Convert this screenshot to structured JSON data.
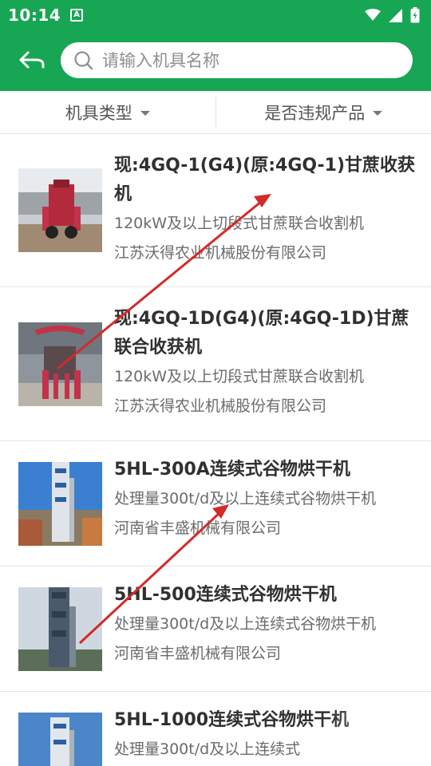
{
  "status_bar": {
    "time": "10:14",
    "notification_letter": "A"
  },
  "header": {
    "search_placeholder": "请输入机具名称"
  },
  "filters": [
    {
      "label": "机具类型"
    },
    {
      "label": "是否违规产品"
    }
  ],
  "items": [
    {
      "title": "现:4GQ-1(G4)(原:4GQ-1)甘蔗收获机",
      "spec": "120kW及以上切段式甘蔗联合收割机",
      "company": "江苏沃得农业机械股份有限公司"
    },
    {
      "title": "现:4GQ-1D(G4)(原:4GQ-1D)甘蔗联合收获机",
      "spec": "120kW及以上切段式甘蔗联合收割机",
      "company": "江苏沃得农业机械股份有限公司"
    },
    {
      "title": "5HL-300A连续式谷物烘干机",
      "spec": "处理量300t/d及以上连续式谷物烘干机",
      "company": "河南省丰盛机械有限公司"
    },
    {
      "title": "5HL-500连续式谷物烘干机",
      "spec": "处理量300t/d及以上连续式谷物烘干机",
      "company": "河南省丰盛机械有限公司"
    },
    {
      "title": "5HL-1000连续式谷物烘干机",
      "spec": "处理量300t/d及以上连续式",
      "company": ""
    }
  ],
  "colors": {
    "brand": "#17a653",
    "annotation_arrow": "#d32a2a"
  }
}
